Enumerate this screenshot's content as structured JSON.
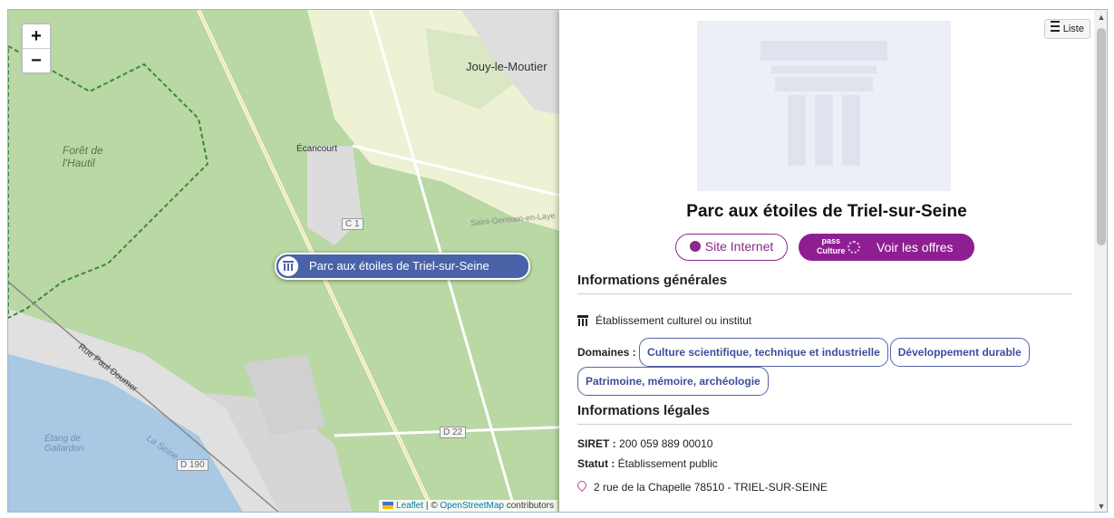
{
  "map": {
    "zoom_in": "+",
    "zoom_out": "−",
    "labels": {
      "forest": "Forêt de l'Hautil",
      "jouy": "Jouy-le-Moutier",
      "ecancourt": "Écancourt",
      "c1": "C 1",
      "d22": "D 22",
      "d190": "D 190",
      "saint_germain": "Saint-Germain-en-Laye",
      "etang": "Étang de Gallardon",
      "la_seine": "La Seine",
      "rue_paul_doumer": "Rue Paul Doumer"
    },
    "marker_label": "Parc aux étoiles de Triel-sur-Seine",
    "attribution": {
      "leaflet": "Leaflet",
      "sep": " | © ",
      "osm": "OpenStreetMap",
      "contributors": " contributors"
    },
    "colors": {
      "forest": "#b9d8a4",
      "fields": "#eef2d4",
      "water": "#a8c8e4",
      "urban": "#dcdcdc",
      "marker": "#4a63a8"
    }
  },
  "panel": {
    "list_button": "Liste",
    "title": "Parc aux étoiles de Triel-sur-Seine",
    "site_button": "Site Internet",
    "pass_logo_top": "pass",
    "pass_logo_bottom": "Culture",
    "offers_button": "Voir les offres",
    "general_heading": "Informations générales",
    "type": "Établissement culturel ou institut",
    "domains_label": "Domaines :",
    "domains": [
      "Culture scientifique, technique et industrielle",
      "Développement durable",
      "Patrimoine, mémoire, archéologie"
    ],
    "legal_heading": "Informations légales",
    "siret_label": "SIRET :",
    "siret_value": "200 059 889 00010",
    "status_label": "Statut :",
    "status_value": "Établissement public",
    "address": "2 rue de la Chapelle 78510 - TRIEL-SUR-SEINE",
    "colors": {
      "accent": "#8e1e92",
      "tag": "#3e4d99"
    }
  }
}
